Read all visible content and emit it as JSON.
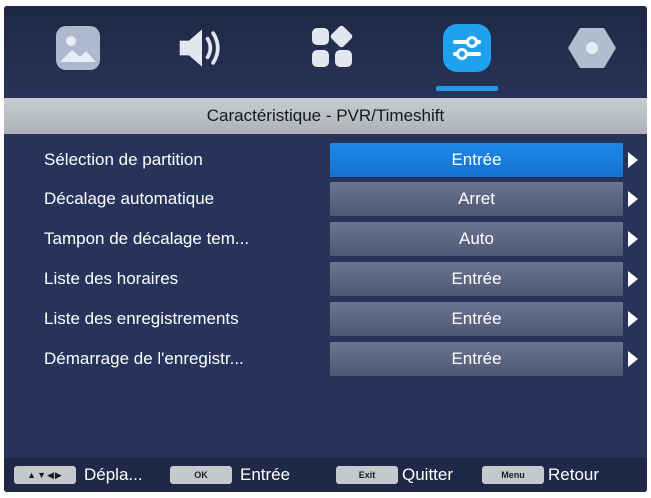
{
  "top_tabs": [
    {
      "icon": "image-icon",
      "selected": false
    },
    {
      "icon": "speaker-icon",
      "selected": false
    },
    {
      "icon": "apps-icon",
      "selected": false
    },
    {
      "icon": "sliders-icon",
      "selected": true
    },
    {
      "icon": "hexagon-icon",
      "selected": false
    }
  ],
  "title": "Caractéristique - PVR/Timeshift",
  "menu": [
    {
      "label": "Sélection de partition",
      "value": "Entrée",
      "selected": true
    },
    {
      "label": "Décalage automatique",
      "value": "Arret",
      "selected": false
    },
    {
      "label": "Tampon de décalage tem...",
      "value": "Auto",
      "selected": false
    },
    {
      "label": "Liste des horaires",
      "value": "Entrée",
      "selected": false
    },
    {
      "label": "Liste des enregistrements",
      "value": "Entrée",
      "selected": false
    },
    {
      "label": "Démarrage de l'enregistr...",
      "value": "Entrée",
      "selected": false
    }
  ],
  "footer": {
    "nav_key": "▲▼◀▶",
    "nav_label": "Dépla...",
    "ok_key": "OK",
    "ok_label": "Entrée",
    "exit_key": "Exit",
    "exit_label": "Quitter",
    "menu_key": "Menu",
    "menu_label": "Retour"
  },
  "colors": {
    "background": "#27335a",
    "accent": "#1d9be8",
    "selected_row": "#1e88e9",
    "value_cell": "#5d6681"
  }
}
